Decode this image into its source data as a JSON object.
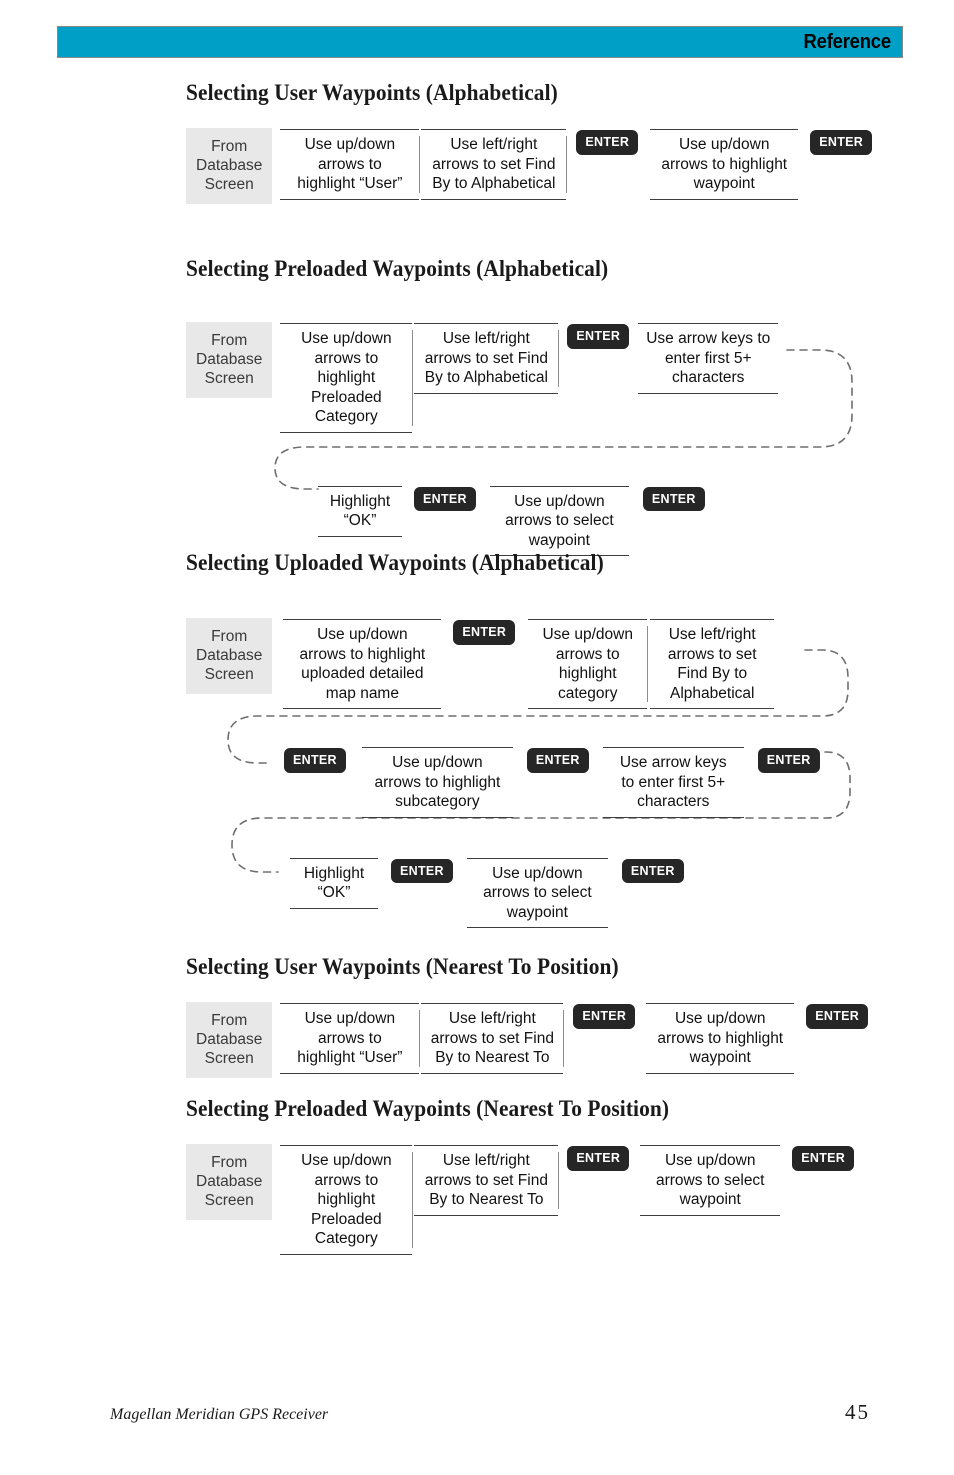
{
  "header": {
    "title": "Reference",
    "bar_color": "#00a0c6"
  },
  "start_box_label": "From\nDatabase\nScreen",
  "start_box": {
    "line1": "From",
    "line2": "Database",
    "line3": "Screen"
  },
  "enter_label": "ENTER",
  "sections": [
    {
      "title": "Selecting User Waypoints (Alphabetical)",
      "rows": [
        {
          "steps": [
            "Use up/down arrows to highlight “User”",
            "Use left/right arrows to set Find By to Alphabetical",
            "ENTER",
            "Use up/down arrows to highlight waypoint",
            "ENTER"
          ]
        }
      ]
    },
    {
      "title": "Selecting Preloaded Waypoints (Alphabetical)",
      "rows": [
        {
          "steps": [
            "Use up/down arrows to highlight Preloaded Category",
            "Use left/right arrows to set Find By to Alphabetical",
            "ENTER",
            "Use arrow keys to enter first 5+ characters"
          ]
        },
        {
          "steps": [
            "Highlight “OK”",
            "ENTER",
            "Use up/down arrows to select waypoint",
            "ENTER"
          ]
        }
      ]
    },
    {
      "title": "Selecting Uploaded Waypoints (Alphabetical)",
      "rows": [
        {
          "steps": [
            "Use up/down arrows to highlight uploaded detailed map name",
            "ENTER",
            "Use up/down arrows to highlight category",
            "Use left/right arrows to set Find By to Alphabetical"
          ]
        },
        {
          "steps": [
            "ENTER",
            "Use up/down arrows to highlight subcategory",
            "ENTER",
            "Use arrow keys to enter first 5+ characters",
            "ENTER"
          ]
        },
        {
          "steps": [
            "Highlight “OK”",
            "ENTER",
            "Use up/down arrows to select waypoint",
            "ENTER"
          ]
        }
      ]
    },
    {
      "title": "Selecting User Waypoints (Nearest To Position)",
      "rows": [
        {
          "steps": [
            "Use up/down arrows to highlight “User”",
            "Use left/right arrows to set Find By to Nearest To",
            "ENTER",
            "Use up/down arrows to highlight waypoint",
            "ENTER"
          ]
        }
      ]
    },
    {
      "title": "Selecting Preloaded Waypoints (Nearest To Position)",
      "rows": [
        {
          "steps": [
            "Use up/down arrows to highlight Preloaded Category",
            "Use left/right arrows to set Find By to Nearest To",
            "ENTER",
            "Use up/down arrows to select waypoint",
            "ENTER"
          ]
        }
      ]
    }
  ],
  "s1": {
    "title": "Selecting User Waypoints (Alphabetical)",
    "step1": "Use up/down\narrows to\nhighlight “User”",
    "step1a": "Use up/down",
    "step1b": "arrows to",
    "step1c": "highlight “User”",
    "step2a": "Use left/right",
    "step2b": "arrows to set Find",
    "step2c": "By to Alphabetical",
    "step4a": "Use up/down",
    "step4b": "arrows to highlight",
    "step4c": "waypoint"
  },
  "s2": {
    "title": "Selecting Preloaded Waypoints (Alphabetical)",
    "step1a": "Use up/down",
    "step1b": "arrows to",
    "step1c": "highlight",
    "step1d": "Preloaded",
    "step1e": "Category",
    "step2a": "Use left/right",
    "step2b": "arrows to set Find",
    "step2c": "By to Alphabetical",
    "step4a": "Use arrow keys to",
    "step4b": "enter first 5+",
    "step4c": "characters",
    "step5a": "Highlight",
    "step5b": "“OK”",
    "step7a": "Use up/down",
    "step7b": "arrows to select",
    "step7c": "waypoint"
  },
  "s3": {
    "title": "Selecting Uploaded Waypoints (Alphabetical)",
    "step1a": "Use up/down",
    "step1b": "arrows to highlight",
    "step1c": "uploaded detailed",
    "step1d": "map name",
    "step3a": "Use up/down",
    "step3b": "arrows to",
    "step3c": "highlight",
    "step3d": "category",
    "step4a": "Use left/right",
    "step4b": "arrows to set",
    "step4c": "Find By to",
    "step4d": "Alphabetical",
    "step6a": "Use up/down",
    "step6b": "arrows to highlight",
    "step6c": "subcategory",
    "step8a": "Use arrow keys",
    "step8b": "to enter first 5+",
    "step8c": "characters",
    "step10a": "Highlight",
    "step10b": "“OK”",
    "step12a": "Use up/down",
    "step12b": "arrows to select",
    "step12c": "waypoint"
  },
  "s4": {
    "title": "Selecting User Waypoints (Nearest To Position)",
    "step1a": "Use up/down",
    "step1b": "arrows to",
    "step1c": "highlight “User”",
    "step2a": "Use left/right",
    "step2b": "arrows to set Find",
    "step2c": "By to Nearest To",
    "step4a": "Use up/down",
    "step4b": "arrows to highlight",
    "step4c": "waypoint"
  },
  "s5": {
    "title": "Selecting Preloaded Waypoints (Nearest To Position)",
    "step1a": "Use up/down",
    "step1b": "arrows to",
    "step1c": "highlight",
    "step1d": "Preloaded",
    "step1e": "Category",
    "step2a": "Use left/right",
    "step2b": "arrows to set Find",
    "step2c": "By to Nearest To",
    "step4a": "Use up/down",
    "step4b": "arrows to select",
    "step4c": "waypoint"
  },
  "footer": {
    "left": "Magellan Meridian GPS Receiver",
    "page": "45"
  }
}
